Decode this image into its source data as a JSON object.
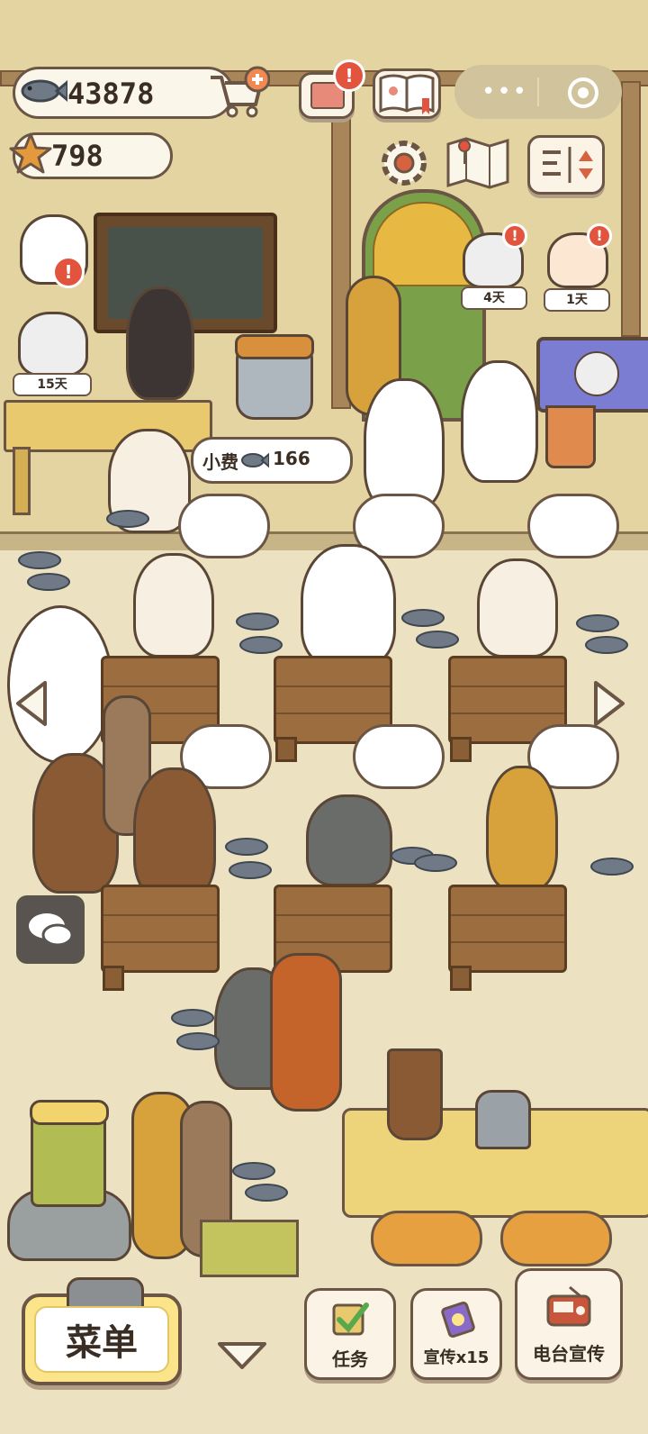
{
  "hud": {
    "fish_count": "43878",
    "star_count": "798"
  },
  "timers": {
    "cat_left": "15天",
    "cat_right_1": "4天",
    "cat_right_2": "1天"
  },
  "tip": {
    "label": "小费",
    "amount": "166"
  },
  "bottom_bar": {
    "menu_label": "菜单",
    "tasks_label": "任务",
    "promo_label": "宣传x15",
    "radio_label": "电台宣传"
  },
  "miniprogram": {
    "more_icon": "more-dots-icon",
    "close_icon": "target-circle-icon"
  },
  "icons": {
    "fish": "fish-icon",
    "star": "star-icon",
    "cart": "cart-plus-icon",
    "mail": "mail-icon",
    "book": "book-icon",
    "settings": "gear-icon",
    "map": "map-icon",
    "layout": "layout-sort-icon",
    "chat": "chat-icon",
    "chevron_left": "chevron-left-icon",
    "chevron_right": "chevron-right-icon",
    "chevron_down": "chevron-down-icon",
    "alert": "!"
  },
  "colors": {
    "wall": "#e4d4a2",
    "floor": "#ece1c1",
    "alert": "#e2543d",
    "menu_button": "#fbe48a"
  }
}
